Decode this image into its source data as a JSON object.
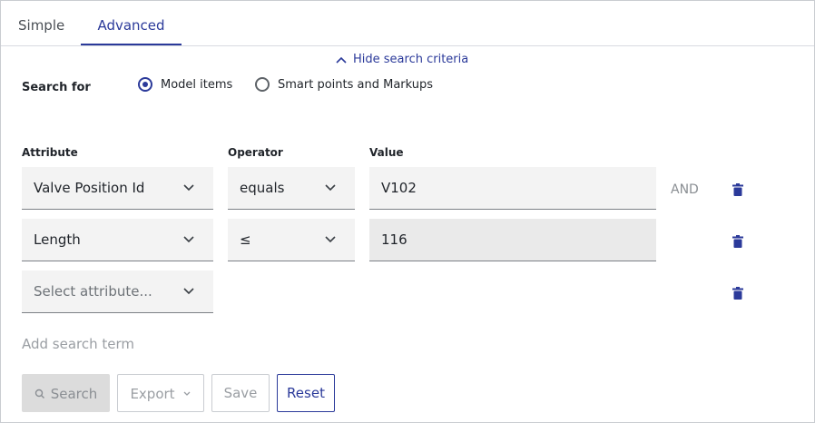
{
  "tabs": [
    {
      "label": "Simple",
      "active": false
    },
    {
      "label": "Advanced",
      "active": true
    }
  ],
  "criteria_toggle": {
    "label": "Hide search criteria",
    "icon": "chevron-up-icon"
  },
  "search_for": {
    "label": "Search for",
    "options": [
      {
        "label": "Model items",
        "selected": true
      },
      {
        "label": "Smart points and Markups",
        "selected": false
      }
    ]
  },
  "columns": {
    "attribute": "Attribute",
    "operator": "Operator",
    "value": "Value"
  },
  "rows": [
    {
      "attribute": "Valve Position Id",
      "operator": "equals",
      "value": "V102",
      "conjunction": "AND"
    },
    {
      "attribute": "Length",
      "operator": "≤",
      "value": "116",
      "conjunction": ""
    }
  ],
  "new_row": {
    "attribute_placeholder": "Select attribute..."
  },
  "add_term_label": "Add search term",
  "buttons": {
    "search": "Search",
    "export": "Export",
    "save": "Save",
    "reset": "Reset"
  },
  "colors": {
    "accent": "#2b3a9a",
    "field_bg": "#f3f3f3",
    "disabled_text": "#9a9ea3"
  }
}
